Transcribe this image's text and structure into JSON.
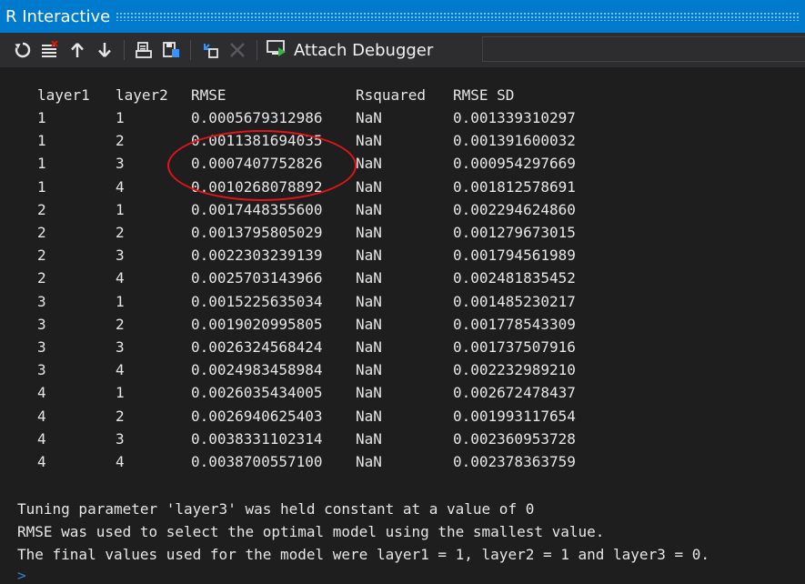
{
  "window": {
    "title": "R Interactive"
  },
  "toolbar": {
    "attach_label": "Attach Debugger",
    "icons": [
      "reset-icon",
      "clear-icon",
      "history-up-icon",
      "history-down-icon",
      "load-workspace-icon",
      "save-workspace-icon",
      "attach-icon",
      "interrupt-icon",
      "debugger-icon"
    ]
  },
  "table": {
    "headers": [
      "layer1",
      "layer2",
      "RMSE",
      "Rsquared",
      "RMSE SD"
    ],
    "rows": [
      [
        "1",
        "1",
        "0.0005679312986",
        "NaN",
        "0.001339310297"
      ],
      [
        "1",
        "2",
        "0.0011381694035",
        "NaN",
        "0.001391600032"
      ],
      [
        "1",
        "3",
        "0.0007407752826",
        "NaN",
        "0.000954297669"
      ],
      [
        "1",
        "4",
        "0.0010268078892",
        "NaN",
        "0.001812578691"
      ],
      [
        "2",
        "1",
        "0.0017448355600",
        "NaN",
        "0.002294624860"
      ],
      [
        "2",
        "2",
        "0.0013795805029",
        "NaN",
        "0.001279673015"
      ],
      [
        "2",
        "3",
        "0.0022303239139",
        "NaN",
        "0.001794561989"
      ],
      [
        "2",
        "4",
        "0.0025703143966",
        "NaN",
        "0.002481835452"
      ],
      [
        "3",
        "1",
        "0.0015225635034",
        "NaN",
        "0.001485230217"
      ],
      [
        "3",
        "2",
        "0.0019020995805",
        "NaN",
        "0.001778543309"
      ],
      [
        "3",
        "3",
        "0.0026324568424",
        "NaN",
        "0.001737507916"
      ],
      [
        "3",
        "4",
        "0.0024983458984",
        "NaN",
        "0.002232989210"
      ],
      [
        "4",
        "1",
        "0.0026035434005",
        "NaN",
        "0.002672478437"
      ],
      [
        "4",
        "2",
        "0.0026940625403",
        "NaN",
        "0.001993117654"
      ],
      [
        "4",
        "3",
        "0.0038331102314",
        "NaN",
        "0.002360953728"
      ],
      [
        "4",
        "4",
        "0.0038700557100",
        "NaN",
        "0.002378363759"
      ]
    ]
  },
  "messages": [
    "Tuning parameter 'layer3' was held constant at a value of 0",
    "RMSE was used to select the optimal model using  the smallest value.",
    "The final values used for the model were layer1 = 1, layer2 = 1 and layer3 = 0."
  ],
  "prompt": {
    "symbol": ">"
  },
  "colors": {
    "titlebar": "#007acc",
    "toolbar": "#2d2d30",
    "console_bg": "#1e1e1e",
    "console_text": "#e6e6e6",
    "annotation": "#e0151b",
    "prompt": "#3a7bd5"
  }
}
